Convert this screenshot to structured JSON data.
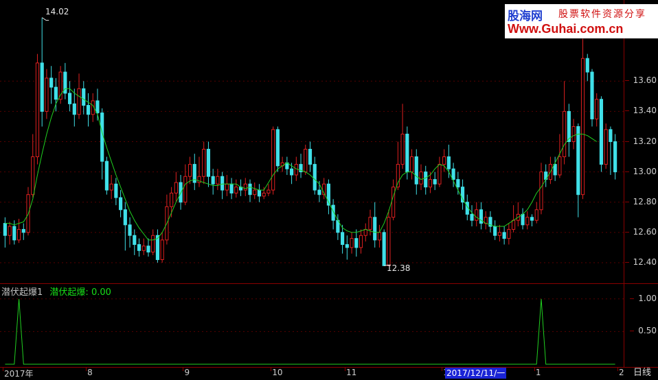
{
  "chart_data": [
    {
      "type": "candlestick",
      "title": "",
      "y_axis": {
        "ticks": [
          "13.60",
          "13.40",
          "13.20",
          "13.00",
          "12.80",
          "12.60",
          "12.40"
        ],
        "ylim": [
          12.3,
          14.1
        ]
      },
      "x_axis": {
        "ticks": [
          {
            "label": "2017年",
            "index": 0
          },
          {
            "label": "8",
            "index": 18
          },
          {
            "label": "9",
            "index": 39
          },
          {
            "label": "10",
            "index": 58
          },
          {
            "label": "11",
            "index": 74
          },
          {
            "label": "12",
            "index": 95
          },
          {
            "label": "1",
            "index": 115
          },
          {
            "label": "2",
            "index": 133
          }
        ]
      },
      "candles": [
        [
          12.66,
          12.58,
          12.7,
          12.5
        ],
        [
          12.58,
          12.64,
          12.67,
          12.52
        ],
        [
          12.64,
          12.55,
          12.68,
          12.52
        ],
        [
          12.55,
          12.62,
          12.69,
          12.53
        ],
        [
          12.62,
          12.6,
          12.66,
          12.55
        ],
        [
          12.6,
          12.85,
          12.9,
          12.58
        ],
        [
          12.85,
          13.1,
          13.25,
          12.83
        ],
        [
          13.1,
          13.72,
          13.78,
          13.05
        ],
        [
          13.72,
          13.4,
          14.02,
          13.3
        ],
        [
          13.4,
          13.62,
          13.68,
          13.35
        ],
        [
          13.62,
          13.56,
          13.7,
          13.45
        ],
        [
          13.56,
          13.48,
          13.62,
          13.4
        ],
        [
          13.48,
          13.66,
          13.7,
          13.45
        ],
        [
          13.66,
          13.52,
          13.72,
          13.48
        ],
        [
          13.52,
          13.45,
          13.6,
          13.4
        ],
        [
          13.45,
          13.38,
          13.55,
          13.3
        ],
        [
          13.38,
          13.55,
          13.65,
          13.35
        ],
        [
          13.55,
          13.44,
          13.6,
          13.38
        ],
        [
          13.44,
          13.38,
          13.52,
          13.3
        ],
        [
          13.38,
          13.47,
          13.52,
          13.33
        ],
        [
          13.47,
          13.39,
          13.55,
          13.34
        ],
        [
          13.39,
          13.07,
          13.42,
          12.95
        ],
        [
          13.07,
          12.88,
          13.1,
          12.85
        ],
        [
          12.88,
          12.92,
          12.98,
          12.82
        ],
        [
          12.92,
          12.83,
          12.96,
          12.78
        ],
        [
          12.83,
          12.75,
          12.88,
          12.7
        ],
        [
          12.75,
          12.65,
          12.8,
          12.48
        ],
        [
          12.65,
          12.58,
          12.7,
          12.5
        ],
        [
          12.58,
          12.52,
          12.62,
          12.45
        ],
        [
          12.52,
          12.48,
          12.56,
          12.44
        ],
        [
          12.48,
          12.51,
          12.56,
          12.45
        ],
        [
          12.51,
          12.47,
          12.56,
          12.44
        ],
        [
          12.47,
          12.58,
          12.62,
          12.45
        ],
        [
          12.58,
          12.42,
          12.62,
          12.4
        ],
        [
          12.42,
          12.55,
          12.6,
          12.4
        ],
        [
          12.55,
          12.77,
          12.85,
          12.52
        ],
        [
          12.77,
          12.86,
          12.9,
          12.7
        ],
        [
          12.86,
          12.93,
          13.0,
          12.8
        ],
        [
          12.93,
          12.8,
          12.98,
          12.75
        ],
        [
          12.8,
          12.97,
          13.05,
          12.78
        ],
        [
          12.97,
          13.05,
          13.1,
          12.92
        ],
        [
          13.05,
          12.93,
          13.12,
          12.88
        ],
        [
          12.93,
          12.97,
          13.1,
          12.9
        ],
        [
          12.97,
          13.15,
          13.2,
          12.92
        ],
        [
          13.15,
          12.97,
          13.2,
          12.9
        ],
        [
          12.97,
          12.92,
          13.02,
          12.85
        ],
        [
          12.92,
          12.97,
          13.02,
          12.88
        ],
        [
          12.97,
          12.88,
          13.0,
          12.82
        ],
        [
          12.88,
          12.92,
          12.98,
          12.84
        ],
        [
          12.92,
          12.86,
          12.96,
          12.82
        ],
        [
          12.86,
          12.9,
          12.95,
          12.83
        ],
        [
          12.9,
          12.88,
          12.95,
          12.84
        ],
        [
          12.88,
          12.92,
          12.96,
          12.84
        ],
        [
          12.92,
          12.85,
          12.95,
          12.8
        ],
        [
          12.85,
          12.88,
          12.93,
          12.82
        ],
        [
          12.88,
          12.84,
          12.92,
          12.8
        ],
        [
          12.84,
          12.86,
          12.9,
          12.82
        ],
        [
          12.86,
          12.88,
          12.92,
          12.84
        ],
        [
          12.88,
          13.28,
          13.3,
          12.85
        ],
        [
          13.28,
          13.04,
          13.3,
          13.0
        ],
        [
          13.04,
          13.06,
          13.1,
          13.0
        ],
        [
          13.06,
          13.02,
          13.1,
          12.98
        ],
        [
          13.02,
          12.98,
          13.06,
          12.92
        ],
        [
          12.98,
          13.05,
          13.1,
          12.94
        ],
        [
          13.05,
          13.0,
          13.12,
          12.96
        ],
        [
          13.0,
          13.15,
          13.18,
          12.98
        ],
        [
          13.15,
          13.05,
          13.2,
          13.0
        ],
        [
          13.05,
          12.88,
          13.1,
          12.85
        ],
        [
          12.88,
          12.85,
          12.94,
          12.8
        ],
        [
          12.85,
          12.92,
          12.96,
          12.82
        ],
        [
          12.92,
          12.78,
          12.95,
          12.72
        ],
        [
          12.78,
          12.68,
          12.82,
          12.62
        ],
        [
          12.68,
          12.6,
          12.72,
          12.55
        ],
        [
          12.6,
          12.52,
          12.65,
          12.46
        ],
        [
          12.52,
          12.5,
          12.58,
          12.42
        ],
        [
          12.5,
          12.56,
          12.6,
          12.46
        ],
        [
          12.56,
          12.5,
          12.62,
          12.44
        ],
        [
          12.5,
          12.58,
          12.62,
          12.46
        ],
        [
          12.58,
          12.62,
          12.66,
          12.54
        ],
        [
          12.62,
          12.7,
          12.75,
          12.58
        ],
        [
          12.7,
          12.55,
          12.8,
          12.5
        ],
        [
          12.55,
          12.6,
          12.65,
          12.5
        ],
        [
          12.6,
          12.38,
          12.62,
          12.38
        ],
        [
          12.38,
          12.7,
          12.75,
          12.38
        ],
        [
          12.7,
          12.9,
          12.95,
          12.68
        ],
        [
          12.9,
          13.05,
          13.2,
          12.88
        ],
        [
          13.05,
          13.25,
          13.45,
          13.02
        ],
        [
          13.25,
          13.0,
          13.3,
          12.95
        ],
        [
          13.0,
          13.1,
          13.15,
          12.95
        ],
        [
          13.1,
          12.92,
          13.15,
          12.85
        ],
        [
          12.92,
          13.0,
          13.05,
          12.88
        ],
        [
          13.0,
          12.9,
          13.04,
          12.85
        ],
        [
          12.9,
          12.95,
          13.0,
          12.86
        ],
        [
          12.95,
          12.92,
          13.0,
          12.88
        ],
        [
          12.92,
          13.05,
          13.1,
          12.9
        ],
        [
          13.05,
          13.1,
          13.15,
          13.0
        ],
        [
          13.1,
          13.02,
          13.18,
          12.96
        ],
        [
          13.02,
          12.95,
          13.06,
          12.9
        ],
        [
          12.95,
          12.9,
          13.0,
          12.85
        ],
        [
          12.9,
          12.8,
          12.95,
          12.75
        ],
        [
          12.8,
          12.72,
          12.85,
          12.68
        ],
        [
          12.72,
          12.68,
          12.78,
          12.64
        ],
        [
          12.68,
          12.75,
          12.8,
          12.64
        ],
        [
          12.75,
          12.66,
          12.8,
          12.62
        ],
        [
          12.66,
          12.7,
          12.74,
          12.62
        ],
        [
          12.7,
          12.64,
          12.74,
          12.6
        ],
        [
          12.64,
          12.58,
          12.68,
          12.55
        ],
        [
          12.58,
          12.6,
          12.65,
          12.54
        ],
        [
          12.6,
          12.56,
          12.64,
          12.52
        ],
        [
          12.56,
          12.62,
          12.66,
          12.52
        ],
        [
          12.62,
          12.68,
          12.78,
          12.6
        ],
        [
          12.68,
          12.72,
          12.8,
          12.64
        ],
        [
          12.72,
          12.65,
          12.76,
          12.62
        ],
        [
          12.65,
          12.7,
          12.74,
          12.62
        ],
        [
          12.7,
          12.68,
          12.72,
          12.64
        ],
        [
          12.68,
          12.75,
          12.8,
          12.66
        ],
        [
          12.75,
          13.0,
          13.06,
          12.72
        ],
        [
          13.0,
          12.95,
          13.05,
          12.9
        ],
        [
          12.95,
          13.05,
          13.1,
          12.92
        ],
        [
          13.05,
          12.98,
          13.1,
          12.94
        ],
        [
          12.98,
          13.1,
          13.25,
          12.96
        ],
        [
          13.1,
          13.4,
          13.6,
          13.05
        ],
        [
          13.4,
          13.2,
          13.45,
          13.1
        ],
        [
          13.2,
          13.3,
          13.35,
          13.15
        ],
        [
          13.3,
          12.85,
          13.32,
          12.7
        ],
        [
          12.85,
          13.75,
          13.88,
          12.82
        ],
        [
          13.75,
          13.66,
          13.78,
          13.6
        ],
        [
          13.66,
          13.35,
          13.68,
          13.3
        ],
        [
          13.35,
          13.48,
          13.52,
          13.3
        ],
        [
          13.48,
          13.05,
          13.5,
          13.0
        ],
        [
          13.05,
          13.28,
          13.32,
          13.02
        ],
        [
          13.28,
          13.2,
          13.3,
          12.98
        ],
        [
          13.2,
          13.0,
          13.25,
          12.95
        ]
      ],
      "ma_line": [
        12.66,
        12.66,
        12.65,
        12.66,
        12.67,
        12.72,
        12.82,
        12.98,
        13.12,
        13.25,
        13.36,
        13.45,
        13.51,
        13.55,
        13.55,
        13.52,
        13.5,
        13.48,
        13.46,
        13.44,
        13.38,
        13.26,
        13.16,
        13.07,
        12.98,
        12.9,
        12.82,
        12.74,
        12.68,
        12.63,
        12.59,
        12.55,
        12.55,
        12.56,
        12.6,
        12.66,
        12.73,
        12.8,
        12.86,
        12.92,
        12.94,
        12.95,
        12.94,
        12.93,
        12.92,
        12.91,
        12.91,
        12.92,
        12.92,
        12.92,
        12.92,
        12.9,
        12.89,
        12.9,
        12.89,
        12.88,
        12.88,
        12.93,
        12.98,
        13.02,
        13.04,
        13.06,
        13.04,
        13.02,
        13.01,
        13.0,
        12.98,
        12.95,
        12.92,
        12.86,
        12.8,
        12.74,
        12.68,
        12.63,
        12.61,
        12.6,
        12.6,
        12.61,
        12.62,
        12.61,
        12.6,
        12.6,
        12.66,
        12.74,
        12.84,
        12.93,
        12.98,
        13.0,
        13.0,
        12.97,
        12.95,
        12.96,
        12.98,
        13.02,
        13.05,
        13.04,
        13.0,
        12.94,
        12.88,
        12.82,
        12.77,
        12.73,
        12.7,
        12.68,
        12.66,
        12.65,
        12.64,
        12.64,
        12.64,
        12.66,
        12.68,
        12.7,
        12.72,
        12.75,
        12.8,
        12.86,
        12.9,
        12.95,
        13.0,
        13.06,
        13.12,
        13.18,
        13.22,
        13.24,
        13.25,
        13.25,
        13.24,
        13.22,
        13.2
      ],
      "annotations": [
        {
          "text": "14.02",
          "candle_index": 8,
          "price": 14.02
        },
        {
          "text": "12.38",
          "candle_index": 82,
          "price": 12.38
        }
      ]
    },
    {
      "type": "line",
      "name": "潜伏起爆",
      "y_axis": {
        "ticks": [
          "1.00",
          "0.50"
        ],
        "ylim": [
          0,
          1.05
        ]
      },
      "x_points": [
        0,
        1,
        2,
        3,
        4,
        5,
        113,
        114,
        115,
        116,
        117,
        118,
        119,
        133
      ],
      "values": [
        0,
        0,
        0,
        1,
        0,
        0,
        0,
        0,
        0,
        1,
        0,
        0,
        0,
        0
      ]
    }
  ],
  "indicator": {
    "label": "潜伏起爆1",
    "name": "潜伏起爆:",
    "value": "0.00"
  },
  "cursor_date": "2017/12/11/一",
  "period": "日线",
  "watermark": {
    "cn1": "股海网",
    "tag": "股票软件资源分享",
    "url": "Www.Guhai.com.cn"
  },
  "colors": {
    "up": "#e02020",
    "down": "#40e0e8",
    "ma": "#20d020",
    "signal": "#20d020",
    "separator": "#8a0000"
  }
}
